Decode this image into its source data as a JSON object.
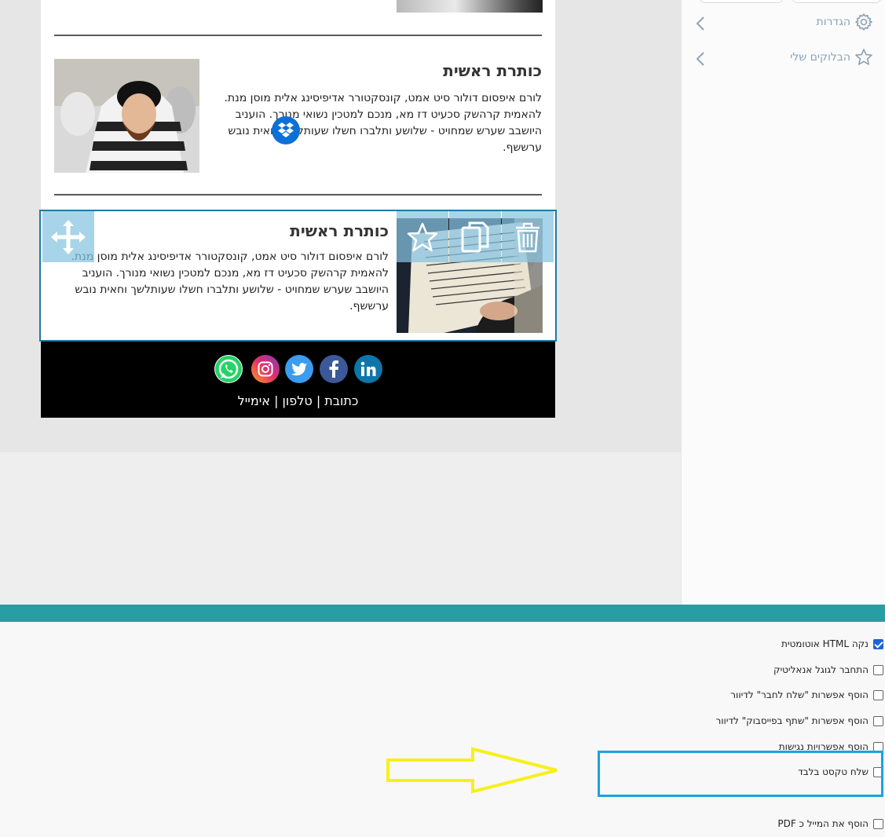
{
  "blocks": [
    {
      "title": "כותרת ראשית",
      "body": "לורם איפסום דולור סיט אמט, קונסקטורר אדיפיסינג אלית מוסן מנת. להאמית קרהשק סכעיט דז מא, מנכם למטכין נשואי מנורך. הועניב היושבב שערש שמחויט - שלושע ותלברו חשלו שעותלשך וחאית נובש ערששף."
    },
    {
      "title": "כותרת ראשית",
      "body": "לורם איפסום דולור סיט אמט, קונסקטורר אדיפיסינג אלית מוסן מנת. להאמית קרהשק סכעיט דז מא, מנכם למטכין נשואי מנורך. הועניב היושבב שערש שמחויט - שלושע ותלברו חשלו שעותלשך וחאית נובש ערששף."
    }
  ],
  "footer": {
    "social": [
      {
        "name": "whatsapp",
        "icon": "whatsapp-icon",
        "color": "#25d366"
      },
      {
        "name": "instagram",
        "icon": "instagram-icon",
        "color": "#c13584"
      },
      {
        "name": "twitter",
        "icon": "twitter-icon",
        "color": "#3b9cf0"
      },
      {
        "name": "facebook",
        "icon": "facebook-icon",
        "color": "#3b5998"
      },
      {
        "name": "linkedin",
        "icon": "linkedin-icon",
        "color": "#0e76a8"
      }
    ],
    "links": "כתובת | טלפון | אימייל"
  },
  "sidebar": {
    "items": [
      {
        "label": "הגדרות",
        "icon": "gear-icon"
      },
      {
        "label": "הבלוקים שלי",
        "icon": "star-icon"
      }
    ]
  },
  "options": [
    {
      "label": "נקה HTML אוטומטית",
      "checked": true
    },
    {
      "label": "התחבר לגוגל אנאליטיק",
      "checked": false
    },
    {
      "label": "הוסף אפשרות \"שלח לחבר\" לדיוור",
      "checked": false
    },
    {
      "label": "הוסף אפשרות \"שתף בפייסבוק\" לדיוור",
      "checked": false
    },
    {
      "label": "הוסף אפשרויות נגישות",
      "checked": false
    },
    {
      "label": "שלח טקסט בלבד",
      "checked": false
    },
    {
      "label": "הוסף את המייל כ PDF",
      "checked": false
    }
  ],
  "colors": {
    "teal": "#269ea4",
    "highlight": "#1aa3e0",
    "arrow": "#f7f01a",
    "selection": "#1f7aa0"
  }
}
